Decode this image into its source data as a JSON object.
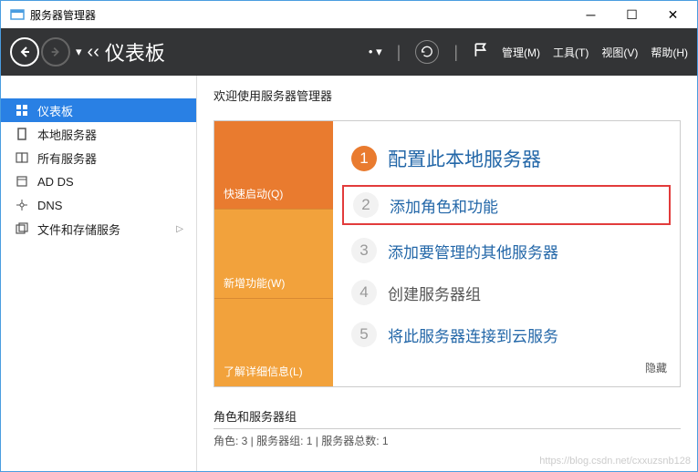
{
  "window": {
    "title": "服务器管理器"
  },
  "header": {
    "page_title": "仪表板",
    "menu": {
      "manage": "管理(M)",
      "tools": "工具(T)",
      "view": "视图(V)",
      "help": "帮助(H)"
    }
  },
  "sidebar": {
    "items": [
      {
        "label": "仪表板"
      },
      {
        "label": "本地服务器"
      },
      {
        "label": "所有服务器"
      },
      {
        "label": "AD DS"
      },
      {
        "label": "DNS"
      },
      {
        "label": "文件和存储服务"
      }
    ]
  },
  "main": {
    "welcome": "欢迎使用服务器管理器",
    "tiles": {
      "quick": "快速启动(Q)",
      "new": "新增功能(W)",
      "more": "了解详细信息(L)"
    },
    "steps": [
      {
        "num": "1",
        "text": "配置此本地服务器"
      },
      {
        "num": "2",
        "text": "添加角色和功能"
      },
      {
        "num": "3",
        "text": "添加要管理的其他服务器"
      },
      {
        "num": "4",
        "text": "创建服务器组"
      },
      {
        "num": "5",
        "text": "将此服务器连接到云服务"
      }
    ],
    "hide": "隐藏",
    "section": {
      "title": "角色和服务器组",
      "sub": "角色: 3 | 服务器组: 1 | 服务器总数: 1"
    }
  },
  "watermark": "https://blog.csdn.net/cxxuzsnb128"
}
